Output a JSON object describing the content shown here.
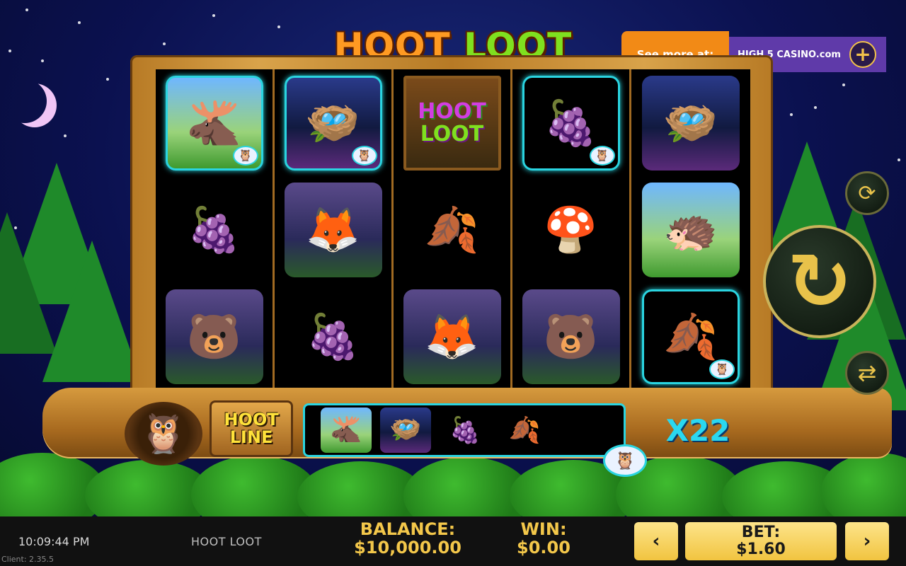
{
  "game": {
    "title_part1": "HOOT",
    "title_part2": "LOOT",
    "logo_line1": "HOOT",
    "logo_line2": "LOOT"
  },
  "promo": {
    "see_more": "See more at:",
    "brand": "HIGH 5 CASINO.com",
    "plus_icon": "plus-icon"
  },
  "reels": [
    [
      {
        "symbol": "moose",
        "glyph": "🫎",
        "bg": "meadow",
        "highlighted": true
      },
      {
        "symbol": "raspberry",
        "glyph": "🍇",
        "bg": "none",
        "highlighted": false
      },
      {
        "symbol": "bear-honey",
        "glyph": "🐻",
        "bg": "forest",
        "highlighted": false
      }
    ],
    [
      {
        "symbol": "nest-eggs",
        "glyph": "🪺",
        "bg": "night",
        "highlighted": true
      },
      {
        "symbol": "fox",
        "glyph": "🦊",
        "bg": "forest",
        "highlighted": false
      },
      {
        "symbol": "raspberry",
        "glyph": "🍇",
        "bg": "none",
        "highlighted": false
      }
    ],
    [
      {
        "symbol": "hoot-loot-logo",
        "glyph": "",
        "bg": "logo",
        "highlighted": false
      },
      {
        "symbol": "leaf",
        "glyph": "🍂",
        "bg": "none",
        "highlighted": false
      },
      {
        "symbol": "fox",
        "glyph": "🦊",
        "bg": "forest",
        "highlighted": false
      }
    ],
    [
      {
        "symbol": "raspberry",
        "glyph": "🍇",
        "bg": "none",
        "highlighted": true
      },
      {
        "symbol": "mushroom",
        "glyph": "🍄",
        "bg": "none",
        "highlighted": false
      },
      {
        "symbol": "bear-honey",
        "glyph": "🐻",
        "bg": "forest",
        "highlighted": false
      }
    ],
    [
      {
        "symbol": "nest-eggs",
        "glyph": "🪺",
        "bg": "night",
        "highlighted": false
      },
      {
        "symbol": "porcupine",
        "glyph": "🦔",
        "bg": "meadow",
        "highlighted": false
      },
      {
        "symbol": "leaf",
        "glyph": "🍂",
        "bg": "none",
        "highlighted": true
      }
    ]
  ],
  "hoot_line": {
    "label_line1": "HOOT",
    "label_line2": "LINE",
    "symbols": [
      {
        "symbol": "moose",
        "glyph": "🫎",
        "bg": "meadow"
      },
      {
        "symbol": "nest-eggs",
        "glyph": "🪺",
        "bg": "night"
      },
      {
        "symbol": "raspberry",
        "glyph": "🍇",
        "bg": "none"
      },
      {
        "symbol": "leaf",
        "glyph": "🍂",
        "bg": "none"
      }
    ],
    "multiplier": "X22"
  },
  "controls": {
    "speed_icon": "turbo-speed-icon",
    "spin_icon": "spin-icon",
    "auto_icon": "autoplay-icon"
  },
  "footer": {
    "time": "10:09:44 PM",
    "client": "Client: 2.35.5",
    "game_name": "HOOT LOOT",
    "balance_label": "BALANCE:",
    "balance_value": "$10,000.00",
    "win_label": "WIN:",
    "win_value": "$0.00",
    "bet_label": "BET:",
    "bet_value": "$1.60",
    "bet_decrease": "‹",
    "bet_increase": "›"
  },
  "colors": {
    "accent_cyan": "#2ad4e0",
    "gold": "#f3c74a",
    "wood": "#b77a25"
  }
}
